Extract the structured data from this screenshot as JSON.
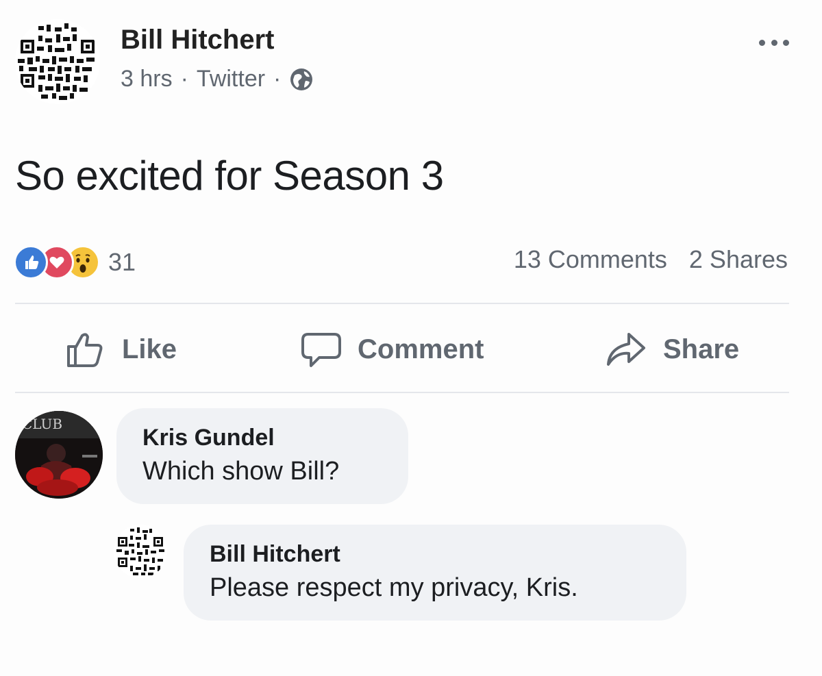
{
  "post": {
    "author": "Bill Hitchert",
    "time": "3 hrs",
    "source": "Twitter",
    "privacy_icon": "globe-icon",
    "text": "So excited for Season 3"
  },
  "reactions": {
    "types": [
      "like",
      "love",
      "wow"
    ],
    "count": "31",
    "comments": "13 Comments",
    "shares": "2 Shares"
  },
  "actions": {
    "like": "Like",
    "comment": "Comment",
    "share": "Share"
  },
  "comments": [
    {
      "author": "Kris Gundel",
      "text": "Which show Bill?",
      "avatar_text": "CLUB"
    },
    {
      "author": "Bill Hitchert",
      "text": "Please respect my privacy, Kris."
    }
  ],
  "colors": {
    "like_blue": "#3b7bd6",
    "love_red": "#e0495f",
    "wow_yellow": "#f5c33b",
    "secondary_text": "#606770",
    "bubble_bg": "#f0f2f5"
  }
}
